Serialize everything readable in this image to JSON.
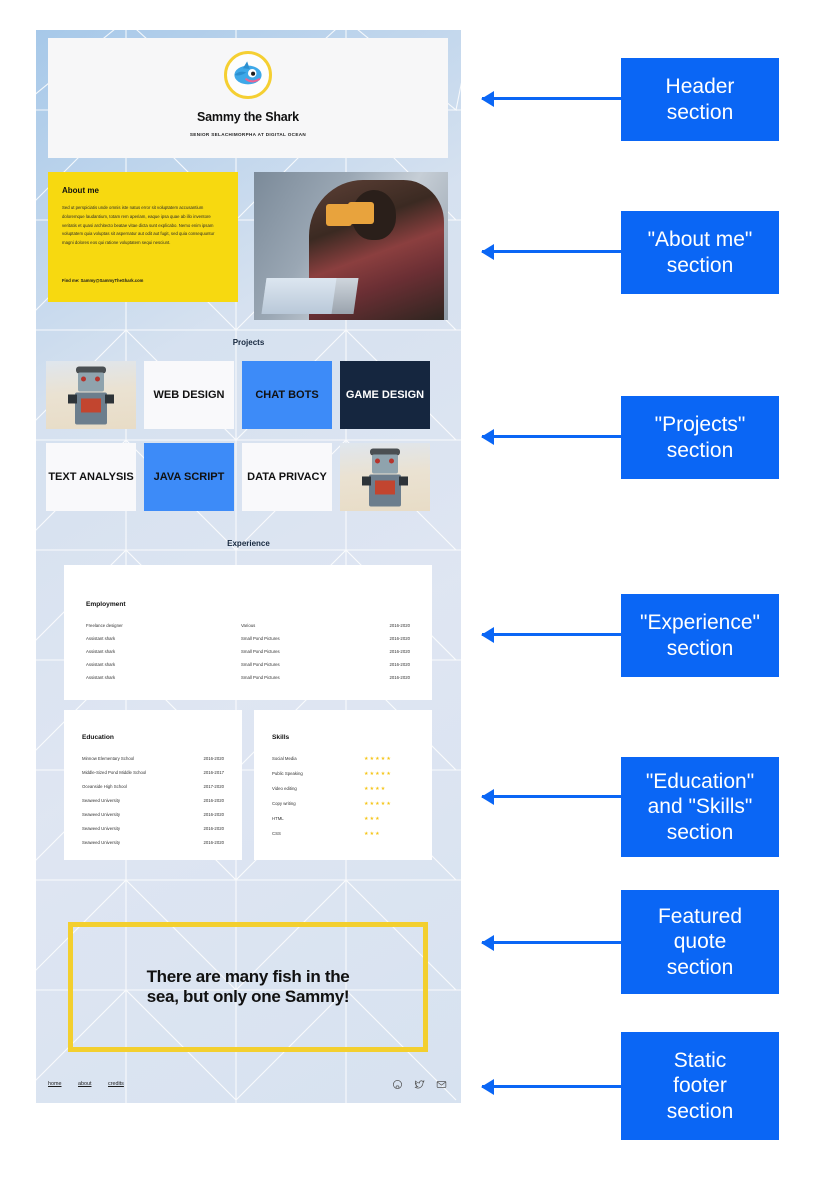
{
  "site": {
    "header": {
      "avatar_icon": "shark-avatar-icon",
      "name": "Sammy the Shark",
      "subtitle": "SENIOR SELACHIMORPHA AT DIGITAL OCEAN"
    },
    "about": {
      "heading": "About me",
      "body": "Sed ut perspiciatis unde omnis iste natus error sit voluptatem accusantium doloremque laudantium, totam rem aperiam, eaque ipsa quae ab illo inventore veritatis et quasi architecto beatae vitae dicta sunt explicabo. Nemo enim ipsam voluptatem quia voluptas sit aspernatur aut odit aut fugit, sed quia consequuntur magni dolores eos qui ratione voluptatem sequi nesciunt.",
      "contact": "Find me: Sammy@SammyTheShark.com",
      "photo_alt": "person-with-headphones-at-laptop"
    },
    "projects": {
      "title": "Projects",
      "cells": [
        {
          "label": "",
          "style": "image",
          "icon": "retro-robot-photo"
        },
        {
          "label": "WEB DESIGN",
          "style": "white"
        },
        {
          "label": "CHAT BOTS",
          "style": "blue"
        },
        {
          "label": "GAME DESIGN",
          "style": "navy"
        },
        {
          "label": "TEXT ANALYSIS",
          "style": "white"
        },
        {
          "label": "JAVA SCRIPT",
          "style": "blue"
        },
        {
          "label": "DATA PRIVACY",
          "style": "white"
        },
        {
          "label": "",
          "style": "image",
          "icon": "retro-robot-photo"
        }
      ]
    },
    "experience": {
      "title": "Experience",
      "heading": "Employment",
      "rows": [
        {
          "role": "Freelance designer",
          "company": "Various",
          "years": "2016-2020"
        },
        {
          "role": "Assistant shark",
          "company": "Small Pond Pictures",
          "years": "2016-2020"
        },
        {
          "role": "Assistant shark",
          "company": "Small Pond Pictures",
          "years": "2016-2020"
        },
        {
          "role": "Assistant shark",
          "company": "Small Pond Pictures",
          "years": "2016-2020"
        },
        {
          "role": "Assistant shark",
          "company": "Small Pond Pictures",
          "years": "2016-2020"
        }
      ]
    },
    "education": {
      "heading": "Education",
      "rows": [
        {
          "school": "Minnow Elementary School",
          "years": "2016-2020"
        },
        {
          "school": "Middle-Sized Pond Middle School",
          "years": "2016-2017"
        },
        {
          "school": "Oceanside High School",
          "years": "2017-2020"
        },
        {
          "school": "Seaweed University",
          "years": "2016-2020"
        },
        {
          "school": "Seaweed University",
          "years": "2016-2020"
        },
        {
          "school": "Seaweed University",
          "years": "2016-2020"
        },
        {
          "school": "Seaweed University",
          "years": "2016-2020"
        }
      ]
    },
    "skills": {
      "heading": "Skills",
      "rows": [
        {
          "name": "Social Media",
          "rating": 5,
          "stars": "★★★★★"
        },
        {
          "name": "Public Speaking",
          "rating": 5,
          "stars": "★★★★★"
        },
        {
          "name": "Video editing",
          "rating": 4,
          "stars": "★★★★"
        },
        {
          "name": "Copy writing",
          "rating": 5,
          "stars": "★★★★★"
        },
        {
          "name": "HTML",
          "rating": 3,
          "stars": "★★★"
        },
        {
          "name": "CSS",
          "rating": 3,
          "stars": "★★★"
        }
      ]
    },
    "quote": {
      "line1": "There are many fish in the",
      "line2": "sea, but only one Sammy!"
    },
    "footer": {
      "links": [
        "home",
        "about",
        "credits"
      ],
      "icons": [
        "github-icon",
        "twitter-icon",
        "mail-icon"
      ]
    }
  },
  "annotations": [
    {
      "id": "header",
      "line1": "Header",
      "line2": "section",
      "line3": ""
    },
    {
      "id": "about",
      "line1": "\"About me\"",
      "line2": "section",
      "line3": ""
    },
    {
      "id": "projects",
      "line1": "\"Projects\"",
      "line2": "section",
      "line3": ""
    },
    {
      "id": "experience",
      "line1": "\"Experience\"",
      "line2": "section",
      "line3": ""
    },
    {
      "id": "education-skills",
      "line1": "\"Education\"",
      "line2": "and \"Skills\"",
      "line3": "section"
    },
    {
      "id": "quote",
      "line1": "Featured",
      "line2": "quote",
      "line3": "section"
    },
    {
      "id": "footer",
      "line1": "Static",
      "line2": "footer",
      "line3": "section"
    }
  ],
  "colors": {
    "accent_blue": "#0a66f5",
    "project_blue": "#3d8bf8",
    "navy": "#15263f",
    "yellow": "#f7d910",
    "quote_border": "#f3cf2e",
    "star": "#f5c518"
  }
}
